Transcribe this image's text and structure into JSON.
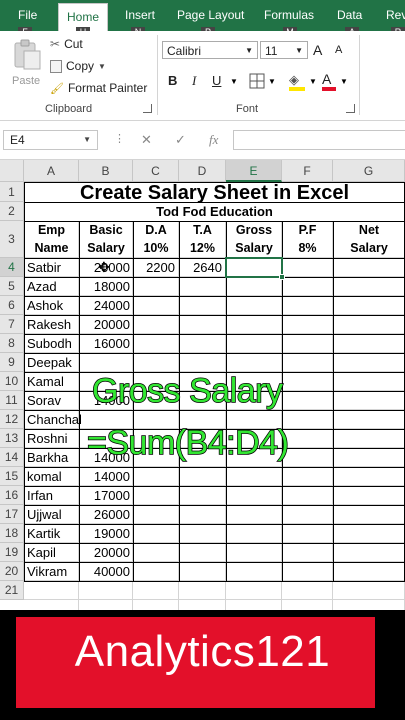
{
  "ribbon": {
    "tabs": [
      "File",
      "Home",
      "Insert",
      "Page Layout",
      "Formulas",
      "Data",
      "Revi"
    ],
    "keytips": [
      "F",
      "H",
      "N",
      "P",
      "M",
      "A",
      "R"
    ],
    "clipboard": {
      "paste": "Paste",
      "cut": "Cut",
      "copy": "Copy",
      "format_painter": "Format Painter",
      "group_label": "Clipboard"
    },
    "font": {
      "name": "Calibri",
      "size": "11",
      "bold": "B",
      "italic": "I",
      "underline": "U",
      "grow": "A",
      "shrink": "A",
      "group_label": "Font"
    }
  },
  "formula_bar": {
    "name_box": "E4",
    "cancel": "✕",
    "enter": "✓",
    "fx": "fx",
    "value": ""
  },
  "sheet": {
    "columns": [
      "A",
      "B",
      "C",
      "D",
      "E",
      "F",
      "G"
    ],
    "rows": [
      "1",
      "2",
      "3",
      "4",
      "5",
      "6",
      "7",
      "8",
      "9",
      "10",
      "11",
      "12",
      "13",
      "14",
      "15",
      "16",
      "17",
      "18",
      "19",
      "20",
      "21"
    ],
    "title": "Create Salary Sheet in Excel",
    "subtitle": "Tod Fod Education",
    "headers": [
      [
        "Emp",
        "Name"
      ],
      [
        "Basic",
        "Salary"
      ],
      [
        "D.A",
        "10%"
      ],
      [
        "T.A",
        "12%"
      ],
      [
        "Gross",
        "Salary"
      ],
      [
        "P.F",
        "8%"
      ],
      [
        "Net",
        "Salary"
      ]
    ],
    "names": [
      "Satbir",
      "Azad",
      "Ashok",
      "Rakesh",
      "Subodh",
      "Deepak",
      "Kamal",
      "Sorav",
      "Chanchal",
      "Roshni",
      "Barkha",
      "komal",
      "Irfan",
      "Ujjwal",
      "Kartik",
      "Kapil",
      "Vikram"
    ],
    "basic": [
      "20000",
      "18000",
      "24000",
      "20000",
      "16000",
      "",
      "",
      "14000",
      "",
      "",
      "14000",
      "14000",
      "17000",
      "26000",
      "19000",
      "20000",
      "40000"
    ],
    "da_row4": "2200",
    "ta_row4": "2640"
  },
  "overlay": {
    "line1": "Gross Salary",
    "line2": "=Sum(B4:D4)"
  },
  "brand": {
    "text": "Analytics121"
  },
  "colors": {
    "excel_green": "#217346",
    "overlay_green": "#32e632",
    "brand_red": "#e3102a"
  }
}
